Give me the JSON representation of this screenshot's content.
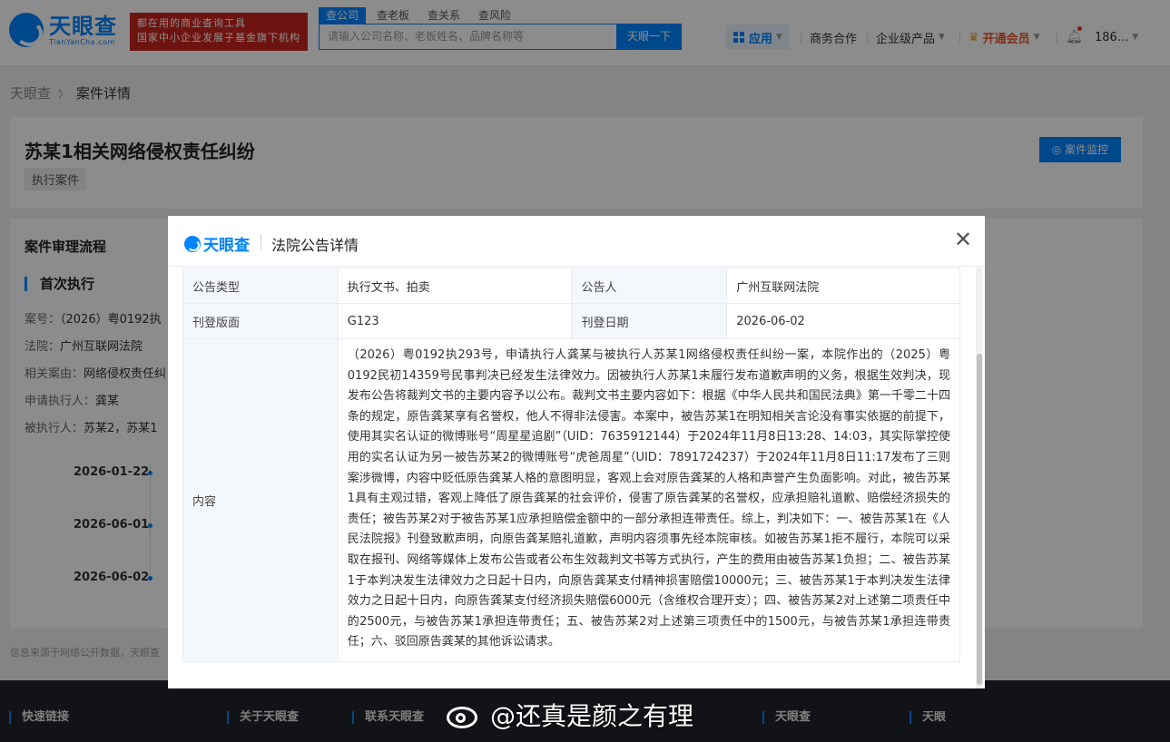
{
  "header": {
    "logo_title": "天眼查",
    "logo_sub": "TianYanCha.com",
    "slogan_line1": "都在用的商业查询工具",
    "slogan_line2": "国家中小企业发展子基金旗下机构",
    "search_tabs": [
      "查公司",
      "查老板",
      "查关系",
      "查风险"
    ],
    "search_placeholder": "请输入公司名称、老板姓名、品牌名称等",
    "search_button": "天眼一下",
    "nav_apps": "应用",
    "nav_business": "商务合作",
    "nav_enterprise": "企业级产品",
    "nav_vip": "开通会员",
    "nav_user": "186..."
  },
  "breadcrumb": {
    "home": "天眼查",
    "current": "案件详情"
  },
  "case": {
    "title": "苏某1相关网络侵权责任纠纷",
    "tag": "执行案件",
    "monitor_button": "案件监控"
  },
  "flow": {
    "title": "案件审理流程",
    "stage": "首次执行",
    "case_no_label": "案号：",
    "case_no_value": "（2026）粤0192执",
    "court_label": "法院：",
    "court_value": "广州互联网法院",
    "cause_label": "相关案由：",
    "cause_value": "网络侵权责任纠",
    "applicant_label": "申请执行人：",
    "applicant_value": "龚某",
    "respondent_label": "被执行人：",
    "respondent_value": "苏某2，苏某1",
    "timeline": [
      "2026-01-22",
      "2026-06-01",
      "2026-06-02"
    ]
  },
  "source_note": "信息来源于网络公开数据，天眼查",
  "footer": {
    "links": [
      "快速链接",
      "关于天眼查",
      "联系天眼查",
      "天眼查",
      "天眼序"
    ]
  },
  "modal": {
    "logo": "天眼查",
    "title": "法院公告详情",
    "type_label": "公告类型",
    "type_value": "执行文书、拍卖",
    "announcer_label": "公告人",
    "announcer_value": "广州互联网法院",
    "page_label": "刊登版面",
    "page_value": "G123",
    "date_label": "刊登日期",
    "date_value": "2026-06-02",
    "content_label": "内容",
    "content_value": "（2026）粤0192执293号，申请执行人龚某与被执行人苏某1网络侵权责任纠纷一案，本院作出的（2025）粤0192民初14359号民事判决已经发生法律效力。因被执行人苏某1未履行发布道歉声明的义务，根据生效判决，现发布公告将裁判文书的主要内容予以公布。裁判文书主要内容如下：根据《中华人民共和国民法典》第一千零二十四条的规定，原告龚某享有名誉权，他人不得非法侵害。本案中，被告苏某1在明知相关言论没有事实依据的前提下，使用其实名认证的微博账号“周星星追剧”（UID：7635912144）于2024年11月8日13:28、14:03，其实际掌控使用的实名认证为另一被告苏某2的微博账号“虎爸周星”（UID：7891724237）于2024年11月8日11:17发布了三则案涉微博，内容中贬低原告龚某人格的意图明显，客观上会对原告龚某的人格和声誉产生负面影响。对此，被告苏某1具有主观过错，客观上降低了原告龚某的社会评价，侵害了原告龚某的名誉权，应承担赔礼道歉、赔偿经济损失的责任；被告苏某2对于被告苏某1应承担赔偿金额中的一部分承担连带责任。综上，判决如下：一、被告苏某1在《人民法院报》刊登致歉声明，向原告龚某赔礼道歉，声明内容须事先经本院审核。如被告苏某1拒不履行，本院可以采取在报刊、网络等媒体上发布公告或者公布生效裁判文书等方式执行，产生的费用由被告苏某1负担；二、被告苏某1于本判决发生法律效力之日起十日内，向原告龚某支付精神损害赔偿10000元；三、被告苏某1于本判决发生法律效力之日起十日内，向原告龚某支付经济损失赔偿6000元（含维权合理开支）；四、被告苏某2对上述第二项责任中的2500元，与被告苏某1承担连带责任；五、被告苏某2对上述第三项责任中的1500元，与被告苏某1承担连带责任；六、驳回原告龚某的其他诉讼请求。"
  },
  "watermark": "@还真是颜之有理",
  "colors": {
    "brand": "#0084ff",
    "slogan_bg": "#c8261e",
    "vip": "#e8572b",
    "footer_bg": "#1f232b"
  }
}
